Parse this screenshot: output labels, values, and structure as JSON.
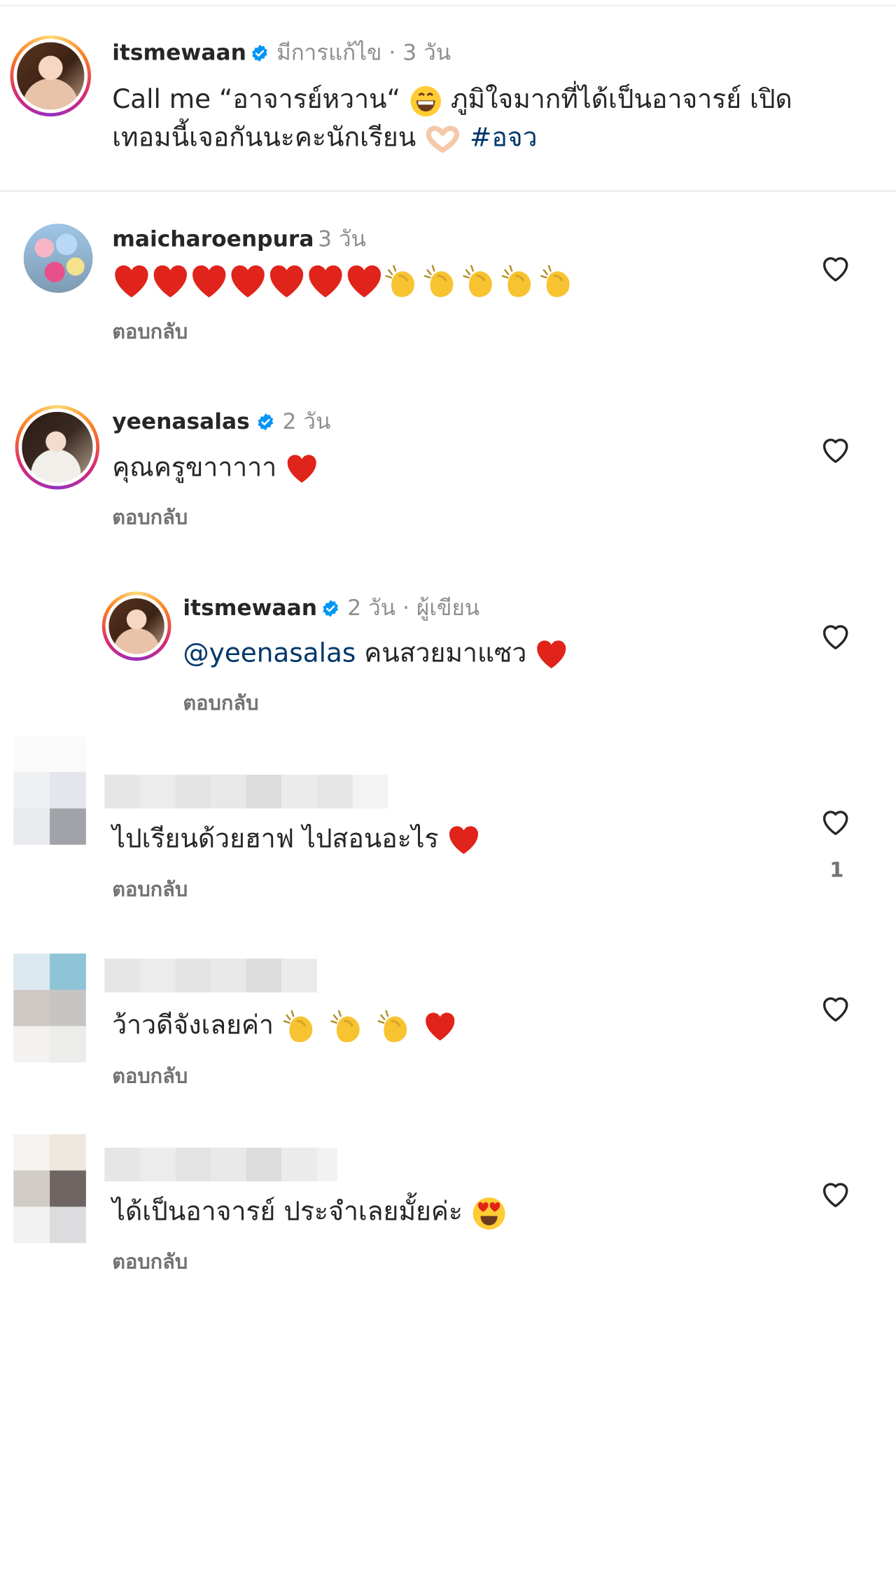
{
  "caption": {
    "username": "itsmewaan",
    "edited_label": "มีการแก้ไข · 3 วัน",
    "line1_prefix": "Call me “อาจารย์หวาน“",
    "line1_suffix": "ภูมิใจมากที่ได้เป็นอาจารย์ เปิด",
    "line2_text": "เทอมนี้เจอกันนะคะนักเรียน",
    "hashtag": "#อจว",
    "emojis": [
      "grinning-face",
      "heart-hands"
    ]
  },
  "comments": [
    {
      "username": "maicharoenpura",
      "time": "3 วัน",
      "verified": false,
      "emoji_text": [
        "red-heart",
        "red-heart",
        "red-heart",
        "red-heart",
        "red-heart",
        "red-heart",
        "red-heart",
        "clapping-hands",
        "clapping-hands",
        "clapping-hands",
        "clapping-hands",
        "clapping-hands"
      ],
      "reply_label": "ตอบกลับ"
    },
    {
      "username": "yeenasalas",
      "time": "2 วัน",
      "verified": true,
      "text": "คุณครูขาาาาา",
      "emoji_after": [
        "red-heart"
      ],
      "reply_label": "ตอบกลับ"
    },
    {
      "username": "itsmewaan",
      "time": "2 วัน · ผู้เขียน",
      "verified": true,
      "mention": "@yeenasalas",
      "text": "คนสวยมาแซว",
      "emoji_after": [
        "red-heart"
      ],
      "reply_label": "ตอบกลับ",
      "is_reply": true
    },
    {
      "username_blurred": true,
      "text": "ไปเรียนด้วยฮาฟ ไปสอนอะไร",
      "emoji_after": [
        "red-heart"
      ],
      "reply_label": "ตอบกลับ",
      "like_count": "1"
    },
    {
      "username_blurred": true,
      "text": "ว้าวดีจังเลยค่า",
      "emoji_after": [
        "clapping-hands",
        "clapping-hands",
        "clapping-hands",
        "red-heart"
      ],
      "reply_label": "ตอบกลับ"
    },
    {
      "username_blurred": true,
      "text": "ได้เป็นอาจารย์ ประจำเลยมั้ยค่ะ",
      "emoji_after": [
        "smiling-face-with-heart-eyes"
      ],
      "reply_label": "ตอบกลับ"
    }
  ],
  "colors": {
    "text": "#262626",
    "meta": "#8e8e8e",
    "link": "#00376b",
    "verified": "#0095f6",
    "heart_red": "#e0241b"
  }
}
